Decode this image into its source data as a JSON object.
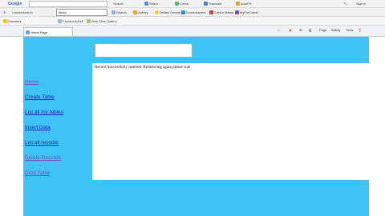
{
  "toolbar1": {
    "logo": "Google",
    "search_label": "Search",
    "share_label": "Share",
    "check_label": "Check",
    "translate_label": "Translate",
    "autofill_label": "AutoFill",
    "signin_label": "Sign in"
  },
  "toolbar2": {
    "address_value": "r.aswebsearch",
    "search_box_value": "sticky",
    "search_label": "Search",
    "items": [
      "Zwinky",
      "Smiley Central",
      "Screensavers",
      "Cursor Mania",
      "MyFunCards"
    ]
  },
  "favorites_bar": {
    "favorites_label": "Favorites",
    "items": [
      "Facebook/Dell",
      "Web Slice Gallery"
    ]
  },
  "tab": {
    "title": "Home Page"
  },
  "command_bar": {
    "items": [
      "Page",
      "Safety",
      "Tools"
    ]
  },
  "page": {
    "message": "Record Successfully inserted. Redirecting again please wait",
    "nav": [
      {
        "label": "Home",
        "visited": true
      },
      {
        "label": "Create Table",
        "visited": false
      },
      {
        "label": "List all my tables",
        "visited": false
      },
      {
        "label": "Insert Data",
        "visited": false
      },
      {
        "label": "List all records",
        "visited": false
      },
      {
        "label": "Delete Records",
        "visited": true
      },
      {
        "label": "Drop Table",
        "visited": true
      }
    ]
  },
  "colors": {
    "brand_band": "#3fc3f5",
    "link": "#1a24c8",
    "visited_link": "#7a4fb5"
  }
}
